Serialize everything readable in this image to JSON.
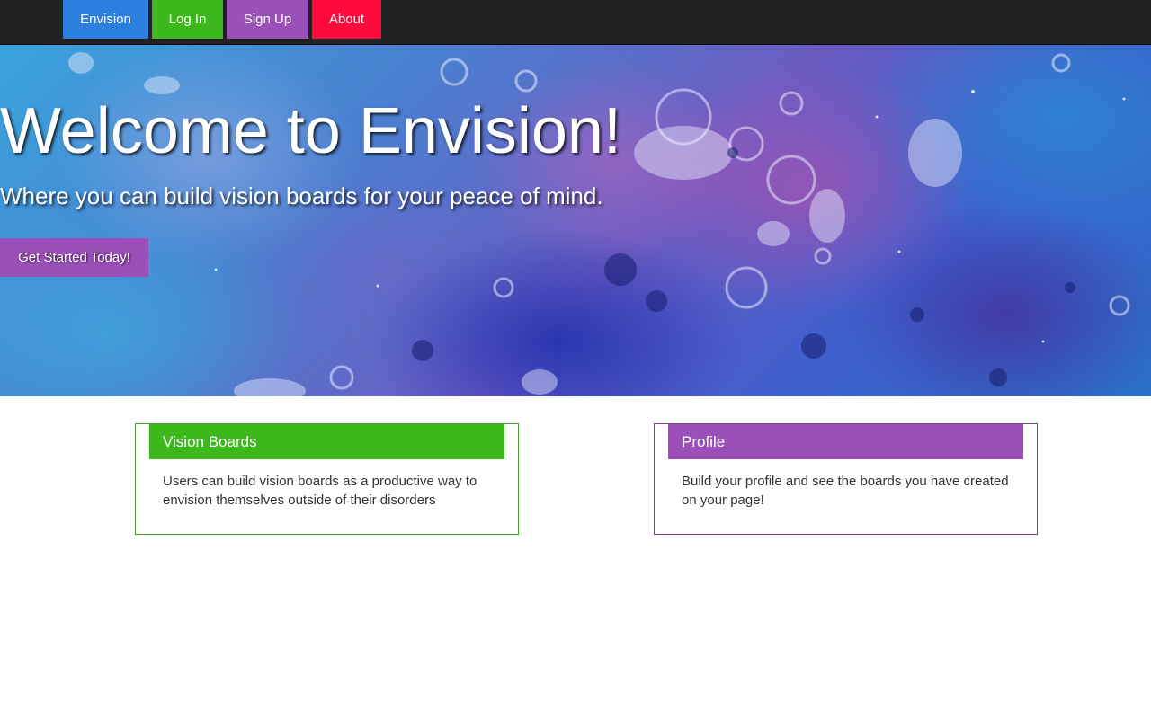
{
  "nav": {
    "items": [
      {
        "label": "Envision",
        "color": "#2a7fdf"
      },
      {
        "label": "Log In",
        "color": "#3cb81c"
      },
      {
        "label": "Sign Up",
        "color": "#9b50b9"
      },
      {
        "label": "About",
        "color": "#ff0a3c"
      }
    ]
  },
  "hero": {
    "title": "Welcome to Envision!",
    "subtitle": "Where you can build vision boards for your peace of mind.",
    "cta_label": "Get Started Today!",
    "cta_color": "#9b50b9"
  },
  "cards": [
    {
      "title": "Vision Boards",
      "body": "Users can build vision boards as a productive way to envision themselves outside of their disorders",
      "accent": "#3cb81c",
      "border": "#4a9a36"
    },
    {
      "title": "Profile",
      "body": "Build your profile and see the boards you have created on your page!",
      "accent": "#9b50b9",
      "border": "#7e3d98"
    }
  ]
}
